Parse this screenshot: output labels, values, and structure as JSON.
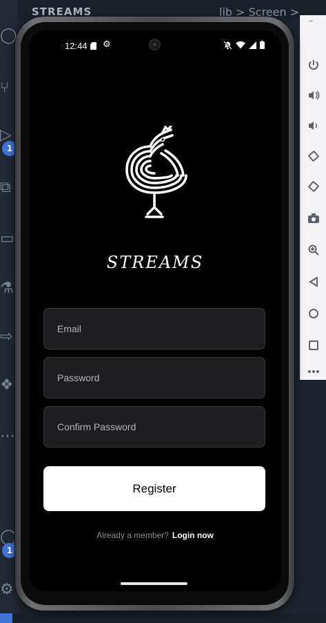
{
  "ide": {
    "title": "STREAMS",
    "breadcrumb": "lib > Screen >",
    "activity_badges": [
      "1",
      "1"
    ],
    "activity_icons": [
      "circle-icon",
      "source-control-icon",
      "run-debug-icon",
      "extensions-icon",
      "remote-explorer-icon",
      "testing-icon",
      "share-icon",
      "python-icon",
      "more-icon",
      "account-icon",
      "settings-icon"
    ]
  },
  "emulator_toolbar": {
    "minimize_label": "–",
    "buttons": [
      {
        "name": "power-icon",
        "glyph": "⏻"
      },
      {
        "name": "volume-up-icon",
        "glyph": "🔊"
      },
      {
        "name": "volume-down-icon",
        "glyph": "🔉"
      },
      {
        "name": "rotate-left-icon",
        "glyph": "◇"
      },
      {
        "name": "rotate-right-icon",
        "glyph": "◈"
      },
      {
        "name": "camera-icon",
        "glyph": "▣"
      },
      {
        "name": "zoom-icon",
        "glyph": "⊕"
      },
      {
        "name": "back-icon",
        "glyph": "◁"
      },
      {
        "name": "home-icon",
        "glyph": "○"
      },
      {
        "name": "overview-icon",
        "glyph": "□"
      },
      {
        "name": "more-icon",
        "glyph": "⋯"
      }
    ]
  },
  "status_bar": {
    "time": "12:44",
    "settings_glyph": "⚙"
  },
  "app": {
    "name": "STREAMS",
    "email_placeholder": "Email",
    "password_placeholder": "Password",
    "confirm_password_placeholder": "Confirm Password",
    "register_label": "Register",
    "login_prompt": "Already a member?",
    "login_link": "Login now"
  },
  "colors": {
    "screen_bg": "#000000",
    "field_bg": "#1e1e20",
    "button_bg": "#ffffff",
    "accent_badge": "#3f74d8"
  }
}
